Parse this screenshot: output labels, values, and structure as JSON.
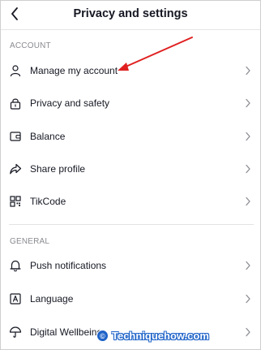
{
  "header": {
    "title": "Privacy and settings",
    "back_icon": "chevron-left-icon"
  },
  "sections": [
    {
      "label": "ACCOUNT",
      "items": [
        {
          "label": "Manage my account",
          "icon": "person-icon"
        },
        {
          "label": "Privacy and safety",
          "icon": "lock-icon"
        },
        {
          "label": "Balance",
          "icon": "wallet-icon"
        },
        {
          "label": "Share profile",
          "icon": "share-icon"
        },
        {
          "label": "TikCode",
          "icon": "qr-code-icon"
        }
      ]
    },
    {
      "label": "GENERAL",
      "items": [
        {
          "label": "Push notifications",
          "icon": "bell-icon"
        },
        {
          "label": "Language",
          "icon": "language-icon"
        },
        {
          "label": "Digital Wellbeing",
          "icon": "umbrella-icon"
        }
      ]
    }
  ],
  "annotation": {
    "arrow_color": "#e02020",
    "points_to": "Manage my account"
  },
  "watermark": {
    "text": "Techniquehow.com",
    "icon_letter": "©",
    "color": "#1e63c8"
  }
}
